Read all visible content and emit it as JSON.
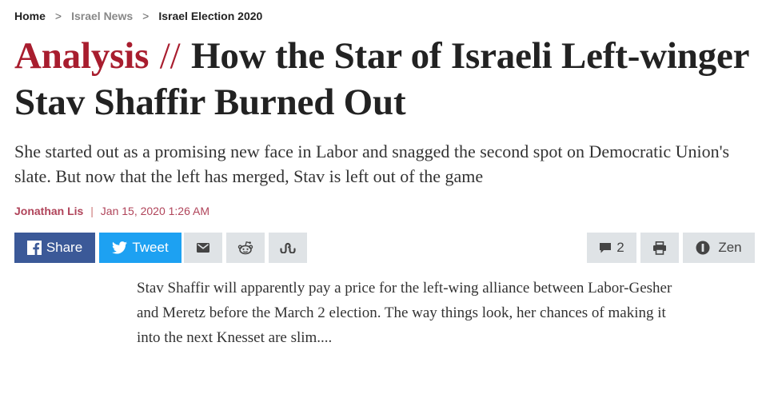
{
  "breadcrumb": {
    "home": "Home",
    "section": "Israel News",
    "topic": "Israel Election 2020",
    "separator": ">"
  },
  "article": {
    "kicker": "Analysis",
    "kicker_separator": "//",
    "title": "How the Star of Israeli Left-winger Stav Shaffir Burned Out",
    "subtitle": "She started out as a promising new face in Labor and snagged the second spot on Democratic Union's slate. But now that the left has merged, Stav is left out of the game",
    "author": "Jonathan Lis",
    "byline_separator": "|",
    "date": "Jan 15, 2020 1:26 AM",
    "body_excerpt": "Stav Shaffir will apparently pay a price for the left-wing alliance between Labor-Gesher and Meretz before the March 2 election. The way things look, her chances of making it into the next Knesset are slim...."
  },
  "share_bar": {
    "facebook_label": "Share",
    "twitter_label": "Tweet",
    "comments_count": "2",
    "zen_label": "Zen",
    "icons": [
      "facebook-icon",
      "twitter-icon",
      "email-icon",
      "reddit-icon",
      "stumbleupon-icon",
      "comment-icon",
      "print-icon",
      "info-icon"
    ]
  },
  "colors": {
    "kicker": "#a81d2e",
    "byline": "#b0445a",
    "facebook": "#3b5998",
    "twitter": "#1da1f2",
    "button_gray": "#dfe3e6"
  }
}
